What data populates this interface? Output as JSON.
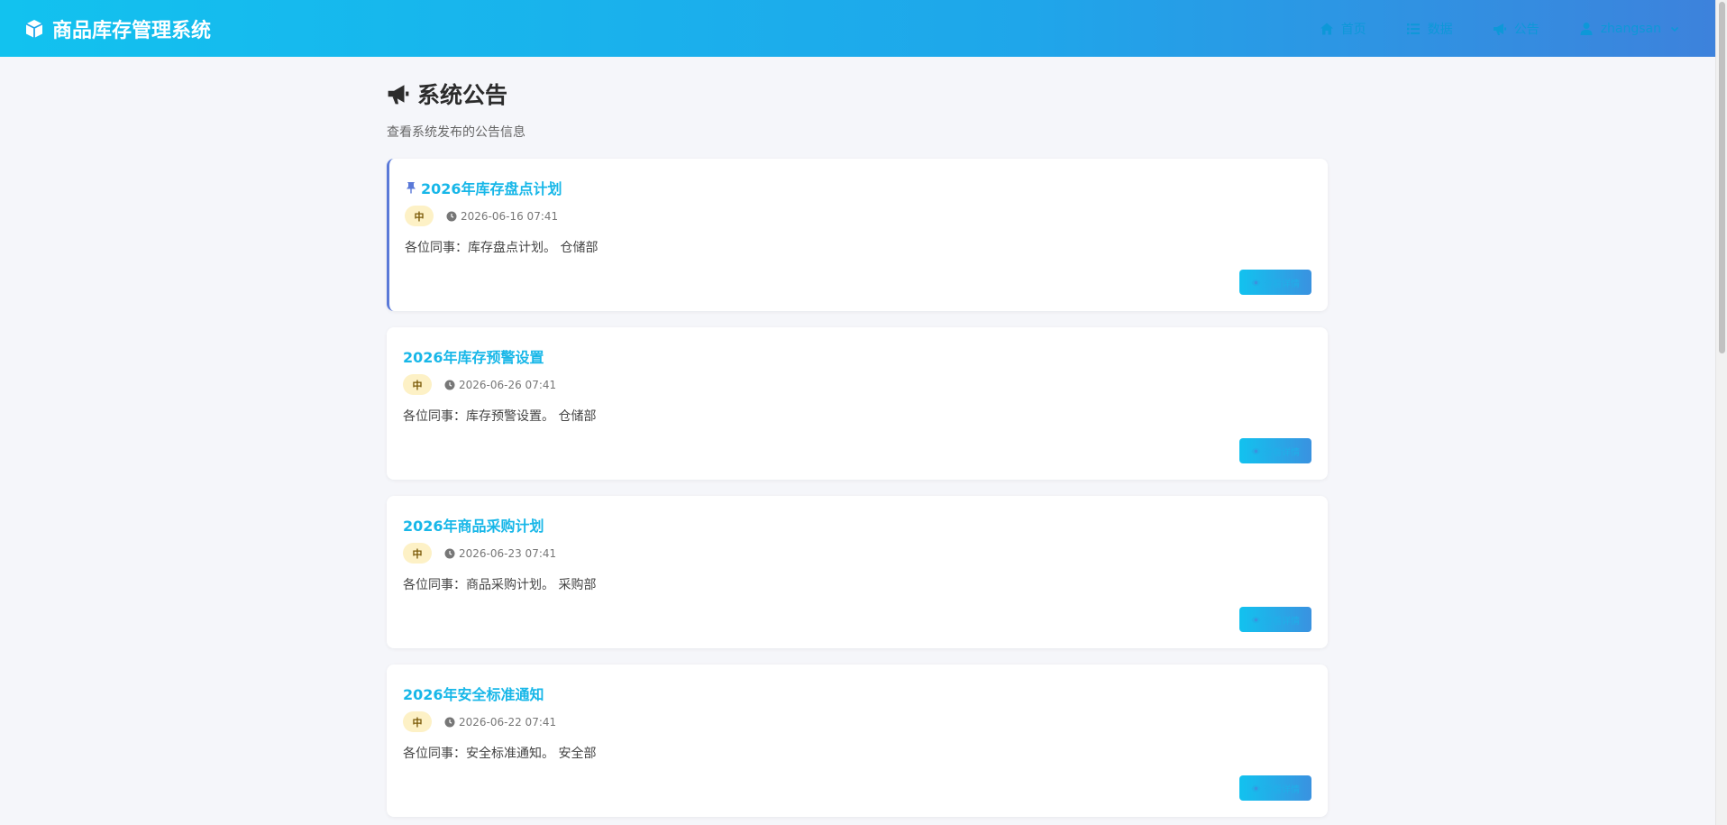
{
  "header": {
    "brand": "商品库存管理系统",
    "nav": [
      {
        "label": "首页",
        "icon": "home-icon"
      },
      {
        "label": "数据",
        "icon": "list-icon"
      },
      {
        "label": "公告",
        "icon": "megaphone-icon"
      }
    ],
    "user": "zhangsan"
  },
  "page": {
    "title": "系统公告",
    "subtitle": "查看系统发布的公告信息"
  },
  "announcements": [
    {
      "title": "2026年库存盘点计划",
      "pinned": true,
      "priority": "中",
      "date": "2026-06-16 07:41",
      "content": "各位同事：库存盘点计划。 仓储部",
      "button": "查看详情"
    },
    {
      "title": "2026年库存预警设置",
      "pinned": false,
      "priority": "中",
      "date": "2026-06-26 07:41",
      "content": "各位同事：库存预警设置。 仓储部",
      "button": "查看详情"
    },
    {
      "title": "2026年商品采购计划",
      "pinned": false,
      "priority": "中",
      "date": "2026-06-23 07:41",
      "content": "各位同事：商品采购计划。 采购部",
      "button": "查看详情"
    },
    {
      "title": "2026年安全标准通知",
      "pinned": false,
      "priority": "中",
      "date": "2026-06-22 07:41",
      "content": "各位同事：安全标准通知。 安全部",
      "button": "查看详情"
    }
  ],
  "colors": {
    "accent": "#18b7e8",
    "pin_border": "#5a79d8",
    "badge_bg": "#fdf1c6"
  }
}
